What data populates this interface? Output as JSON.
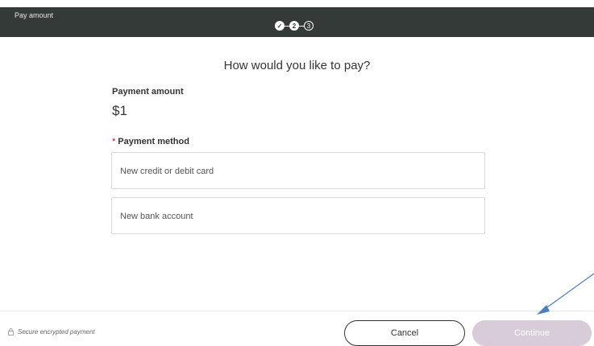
{
  "header": {
    "title": "Pay amount",
    "steps": [
      {
        "label": "✓",
        "state": "done"
      },
      {
        "label": "2",
        "state": "current"
      },
      {
        "label": "3",
        "state": "next"
      }
    ]
  },
  "main": {
    "heading": "How would you like to pay?",
    "amount_label": "Payment amount",
    "amount_value": "$1",
    "method_required_mark": "*",
    "method_label": "Payment method",
    "options": [
      "New credit or debit card",
      "New bank account"
    ]
  },
  "footer": {
    "secure_text": "Secure encrypted payment",
    "cancel_label": "Cancel",
    "continue_label": "Continue",
    "continue_disabled": true
  },
  "colors": {
    "header_bg": "#343a38",
    "continue_bg_disabled": "#d7ccd7",
    "required_mark": "#d0021b",
    "annotation_arrow": "#4a7fc1"
  },
  "icons": [
    "checkmark-icon",
    "lock-icon",
    "annotation-arrow"
  ]
}
